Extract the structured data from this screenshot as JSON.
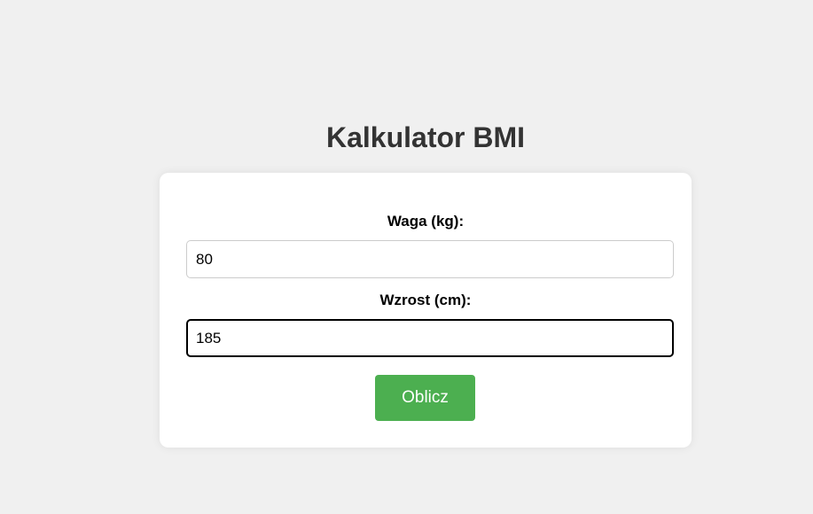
{
  "page": {
    "title": "Kalkulator BMI"
  },
  "form": {
    "weight_label": "Waga (kg):",
    "weight_value": "80",
    "height_label": "Wzrost (cm):",
    "height_value": "185",
    "submit_label": "Oblicz"
  },
  "colors": {
    "background": "#f0f0f0",
    "card": "#ffffff",
    "button": "#4caf50",
    "title": "#333333"
  }
}
